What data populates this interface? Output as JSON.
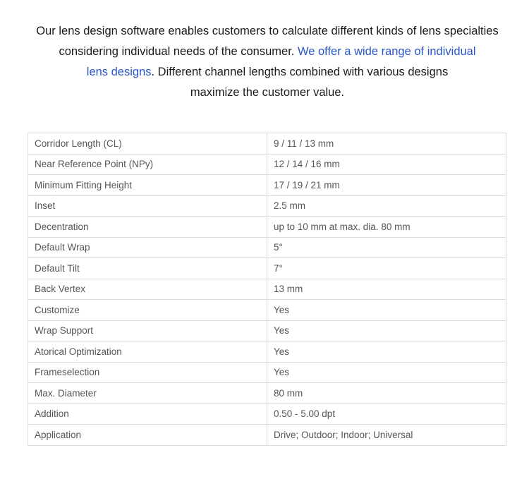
{
  "intro": {
    "line1": "Our lens design software enables customers to calculate different kinds of lens specialties",
    "line2_text": "considering individual needs of the consumer.",
    "link_part1": "We offer a wide range of individual",
    "link_part2": "lens designs",
    "line3_rest": ". Different channel lengths combined with various designs",
    "line4": "maximize the customer value."
  },
  "specs": [
    {
      "name": "Corridor Length (CL)",
      "value": "9 / 11 / 13 mm"
    },
    {
      "name": "Near Reference Point (NPy)",
      "value": "12 / 14 / 16 mm"
    },
    {
      "name": "Minimum Fitting Height",
      "value": "17 / 19 / 21 mm"
    },
    {
      "name": "Inset",
      "value": "2.5 mm"
    },
    {
      "name": "Decentration",
      "value": "up to 10 mm at max. dia. 80 mm"
    },
    {
      "name": "Default Wrap",
      "value": "5°"
    },
    {
      "name": "Default Tilt",
      "value": "7°"
    },
    {
      "name": "Back Vertex",
      "value": "13 mm"
    },
    {
      "name": "Customize",
      "value": "Yes"
    },
    {
      "name": "Wrap Support",
      "value": "Yes"
    },
    {
      "name": "Atorical Optimization",
      "value": "Yes"
    },
    {
      "name": "Frameselection",
      "value": "Yes"
    },
    {
      "name": "Max. Diameter",
      "value": "80 mm"
    },
    {
      "name": "Addition",
      "value": "0.50 - 5.00 dpt"
    },
    {
      "name": "Application",
      "value": "Drive; Outdoor; Indoor; Universal"
    }
  ]
}
